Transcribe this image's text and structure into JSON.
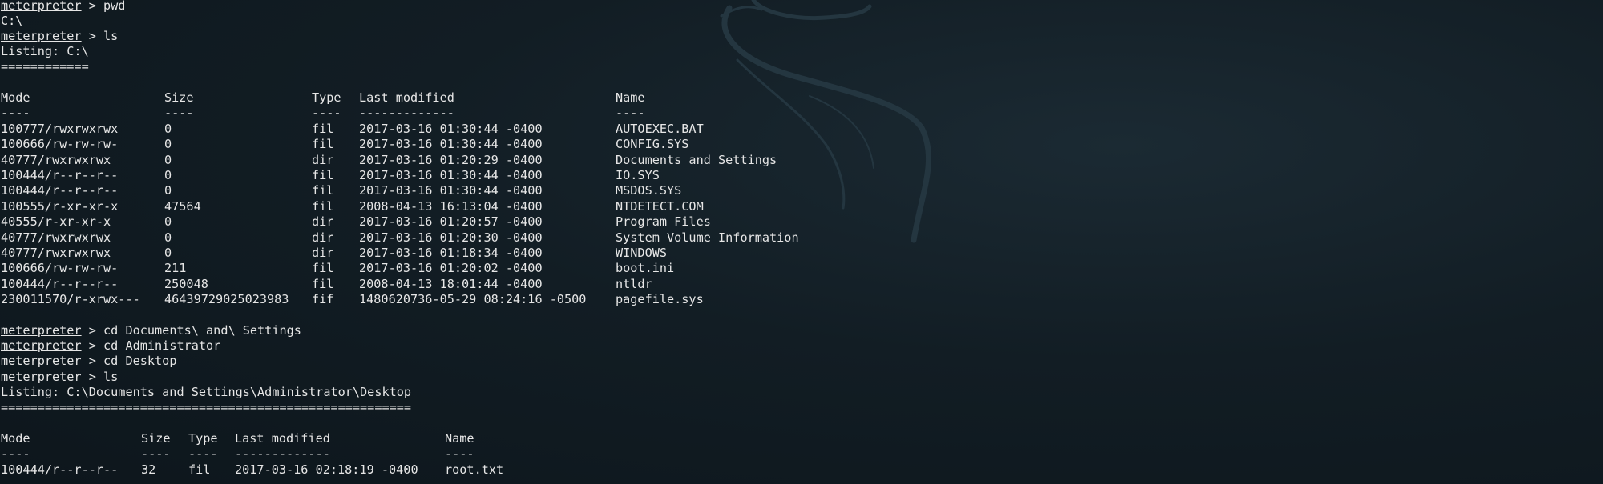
{
  "prompt": "meterpreter",
  "session1": {
    "cmd_pwd": " > pwd",
    "pwd_output": "C:\\",
    "cmd_ls": " > ls",
    "listing": "Listing: C:\\",
    "underline": "============",
    "headers": [
      "Mode",
      "Size",
      "Type",
      "Last modified",
      "Name"
    ],
    "header_dashes": [
      "----",
      "----",
      "----",
      "-------------",
      "----"
    ],
    "rows": [
      [
        "100777/rwxrwxrwx",
        "0",
        "fil",
        "2017-03-16 01:30:44 -0400",
        "AUTOEXEC.BAT"
      ],
      [
        "100666/rw-rw-rw-",
        "0",
        "fil",
        "2017-03-16 01:30:44 -0400",
        "CONFIG.SYS"
      ],
      [
        "40777/rwxrwxrwx",
        "0",
        "dir",
        "2017-03-16 01:20:29 -0400",
        "Documents and Settings"
      ],
      [
        "100444/r--r--r--",
        "0",
        "fil",
        "2017-03-16 01:30:44 -0400",
        "IO.SYS"
      ],
      [
        "100444/r--r--r--",
        "0",
        "fil",
        "2017-03-16 01:30:44 -0400",
        "MSDOS.SYS"
      ],
      [
        "100555/r-xr-xr-x",
        "47564",
        "fil",
        "2008-04-13 16:13:04 -0400",
        "NTDETECT.COM"
      ],
      [
        "40555/r-xr-xr-x",
        "0",
        "dir",
        "2017-03-16 01:20:57 -0400",
        "Program Files"
      ],
      [
        "40777/rwxrwxrwx",
        "0",
        "dir",
        "2017-03-16 01:20:30 -0400",
        "System Volume Information"
      ],
      [
        "40777/rwxrwxrwx",
        "0",
        "dir",
        "2017-03-16 01:18:34 -0400",
        "WINDOWS"
      ],
      [
        "100666/rw-rw-rw-",
        "211",
        "fil",
        "2017-03-16 01:20:02 -0400",
        "boot.ini"
      ],
      [
        "100444/r--r--r--",
        "250048",
        "fil",
        "2008-04-13 18:01:44 -0400",
        "ntldr"
      ],
      [
        "230011570/r-xrwx---",
        "46439729025023983",
        "fif",
        "1480620736-05-29 08:24:16 -0500",
        "pagefile.sys"
      ]
    ]
  },
  "session2": {
    "cmd_cd1": " > cd Documents\\ and\\ Settings",
    "cmd_cd2": " > cd Administrator",
    "cmd_cd3": " > cd Desktop",
    "cmd_ls": " > ls",
    "listing": "Listing: C:\\Documents and Settings\\Administrator\\Desktop",
    "underline": "========================================================",
    "headers": [
      "Mode",
      "Size",
      "Type",
      "Last modified",
      "Name"
    ],
    "header_dashes": [
      "----",
      "----",
      "----",
      "-------------",
      "----"
    ],
    "rows": [
      [
        "100444/r--r--r--",
        "32",
        "fil",
        "2017-03-16 02:18:19 -0400",
        "root.txt"
      ]
    ]
  },
  "colors": {
    "text": "#e6e6e6",
    "background": "#121d24",
    "logo_stroke": "#2a3a44"
  },
  "icons": {
    "background_logo": "kali-dragon-logo"
  }
}
